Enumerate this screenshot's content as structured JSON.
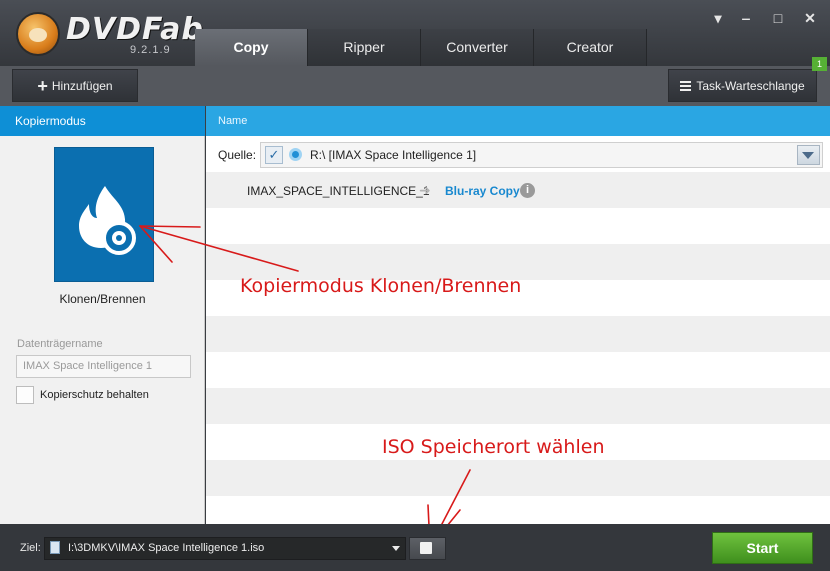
{
  "app": {
    "brand": "DVDFab",
    "version": "9.2.1.9"
  },
  "tabs": [
    {
      "label": "Copy",
      "active": true
    },
    {
      "label": "Ripper"
    },
    {
      "label": "Converter"
    },
    {
      "label": "Creator"
    }
  ],
  "window_controls": {
    "menu": "▾",
    "minimize": "‒",
    "maximize": "□",
    "close": "✕"
  },
  "toolbar": {
    "add_label": "Hinzufügen",
    "add_symbol": "+",
    "queue_label": "Task-Warteschlange",
    "queue_badge": "1"
  },
  "left_panel": {
    "header": "Kopiermodus",
    "mode_label": "Klonen/Brennen",
    "disc_name_label": "Datenträgername",
    "disc_name_value": "IMAX Space Intelligence 1",
    "keep_protection_label": "Kopierschutz behalten"
  },
  "right_panel": {
    "header": "Name",
    "source_label": "Quelle:",
    "source_value": "R:\\ [IMAX Space Intelligence 1]",
    "title_name": "IMAX_SPACE_INTELLIGENCE_1",
    "copy_mode_link": "Blu-ray Copy",
    "info_symbol": "i"
  },
  "annotations": {
    "mode": "Kopiermodus Klonen/Brennen",
    "iso": "ISO Speicherort wählen"
  },
  "bottom": {
    "target_label": "Ziel:",
    "target_path": "I:\\3DMKV\\IMAX Space Intelligence 1.iso",
    "start_label": "Start"
  },
  "colors": {
    "accent": "#0e8fd6",
    "link": "#1888cf",
    "annotation": "#d81a1a",
    "start": "#56a82c"
  }
}
